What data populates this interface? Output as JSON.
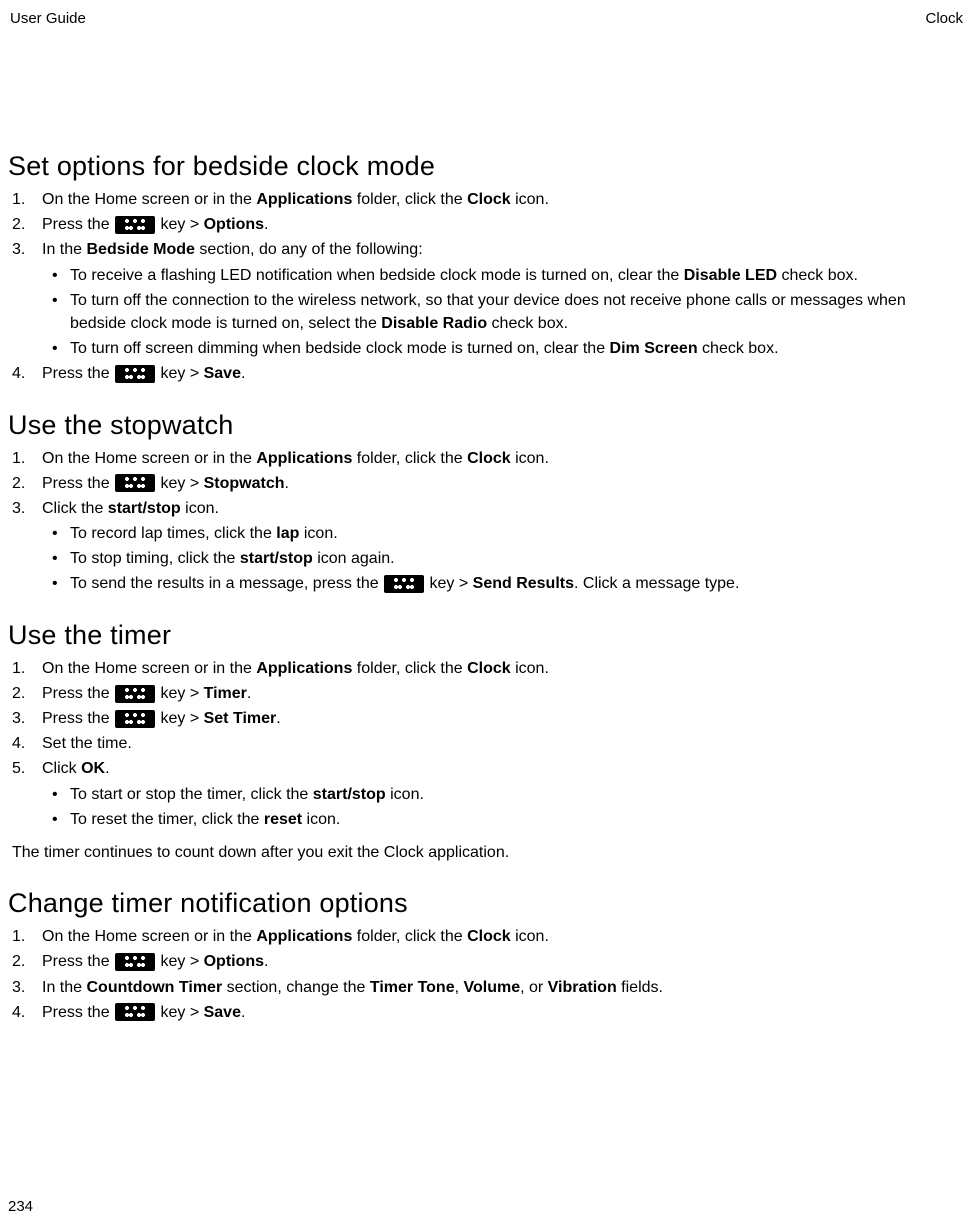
{
  "header": {
    "left": "User Guide",
    "right": "Clock"
  },
  "footer": {
    "page": "234"
  },
  "key_alt": "Menu",
  "s1": {
    "title": "Set options for bedside clock mode",
    "i1a": "On the Home screen or in the ",
    "i1b": "Applications",
    "i1c": " folder, click the ",
    "i1d": "Clock",
    "i1e": " icon.",
    "i2a": "Press the ",
    "i2b": " key > ",
    "i2c": "Options",
    "i2d": ".",
    "i3a": "In the ",
    "i3b": "Bedside Mode",
    "i3c": " section, do any of the following:",
    "b1a": "To receive a flashing LED notification when bedside clock mode is turned on, clear the ",
    "b1b": "Disable LED",
    "b1c": " check box.",
    "b2a": "To turn off the connection to the wireless network, so that your device does not receive phone calls or messages when bedside clock mode is turned on, select the ",
    "b2b": "Disable Radio",
    "b2c": " check box.",
    "b3a": "To turn off screen dimming when bedside clock mode is turned on, clear the ",
    "b3b": "Dim Screen",
    "b3c": " check box.",
    "i4a": "Press the ",
    "i4b": " key > ",
    "i4c": "Save",
    "i4d": "."
  },
  "s2": {
    "title": "Use the stopwatch",
    "i1a": "On the Home screen or in the ",
    "i1b": "Applications",
    "i1c": " folder, click the ",
    "i1d": "Clock",
    "i1e": " icon.",
    "i2a": "Press the ",
    "i2b": " key > ",
    "i2c": "Stopwatch",
    "i2d": ".",
    "i3a": "Click the ",
    "i3b": "start/stop",
    "i3c": " icon.",
    "b1a": "To record lap times, click the ",
    "b1b": "lap",
    "b1c": " icon.",
    "b2a": "To stop timing, click the ",
    "b2b": "start/stop",
    "b2c": " icon again.",
    "b3a": "To send the results in a message, press the ",
    "b3b": " key > ",
    "b3c": "Send Results",
    "b3d": ". Click a message type."
  },
  "s3": {
    "title": "Use the timer",
    "i1a": "On the Home screen or in the ",
    "i1b": "Applications",
    "i1c": " folder, click the ",
    "i1d": "Clock",
    "i1e": " icon.",
    "i2a": "Press the ",
    "i2b": " key > ",
    "i2c": "Timer",
    "i2d": ".",
    "i3a": "Press the ",
    "i3b": " key > ",
    "i3c": "Set Timer",
    "i3d": ".",
    "i4": "Set the time.",
    "i5a": "Click ",
    "i5b": "OK",
    "i5c": ".",
    "b1a": "To start or stop the timer, click the ",
    "b1b": "start/stop",
    "b1c": " icon.",
    "b2a": "To reset the timer, click the ",
    "b2b": "reset",
    "b2c": " icon.",
    "note": "The timer continues to count down after you exit the Clock application."
  },
  "s4": {
    "title": "Change timer notification options",
    "i1a": "On the Home screen or in the ",
    "i1b": "Applications",
    "i1c": " folder, click the ",
    "i1d": "Clock",
    "i1e": " icon.",
    "i2a": "Press the ",
    "i2b": " key > ",
    "i2c": "Options",
    "i2d": ".",
    "i3a": "In the ",
    "i3b": "Countdown Timer",
    "i3c": " section, change the ",
    "i3d": "Timer Tone",
    "i3e": ", ",
    "i3f": "Volume",
    "i3g": ", or ",
    "i3h": "Vibration",
    "i3i": " fields.",
    "i4a": "Press the ",
    "i4b": " key > ",
    "i4c": "Save",
    "i4d": "."
  }
}
